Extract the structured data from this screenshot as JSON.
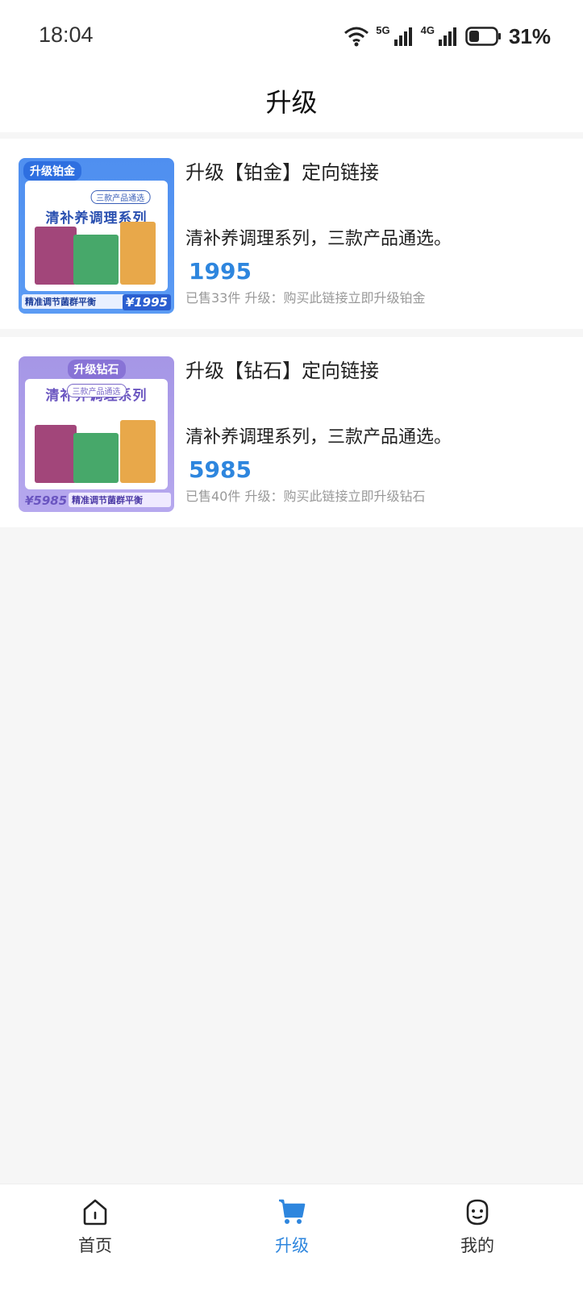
{
  "status_bar": {
    "time": "18:04",
    "network_1": "5G",
    "network_2": "4G",
    "battery": "31%"
  },
  "header": {
    "title": "升级"
  },
  "products": [
    {
      "thumb_tag": "升级铂金",
      "thumb_chip": "三款产品通选",
      "thumb_series": "清补养调理系列",
      "thumb_slogan": "精准调节菌群平衡",
      "thumb_price": "¥1995",
      "title": "升级【铂金】定向链接",
      "description": "清补养调理系列，三款产品通选。",
      "price": "1995",
      "meta": "已售33件  升级：购买此链接立即升级铂金"
    },
    {
      "thumb_tag": "升级钻石",
      "thumb_chip": "三款产品通选",
      "thumb_series": "清补养调理系列",
      "thumb_slogan": "精准调节菌群平衡",
      "thumb_price": "¥5985",
      "title": "升级【钻石】定向链接",
      "description": "清补养调理系列，三款产品通选。",
      "price": "5985",
      "meta": "已售40件  升级：购买此链接立即升级钻石"
    }
  ],
  "tabbar": {
    "home": {
      "label": "首页",
      "icon": "home-icon"
    },
    "upgrade": {
      "label": "升级",
      "icon": "cart-icon",
      "active": true
    },
    "mine": {
      "label": "我的",
      "icon": "face-icon"
    }
  },
  "colors": {
    "accent": "#2e86de",
    "background": "#f6f6f6"
  }
}
